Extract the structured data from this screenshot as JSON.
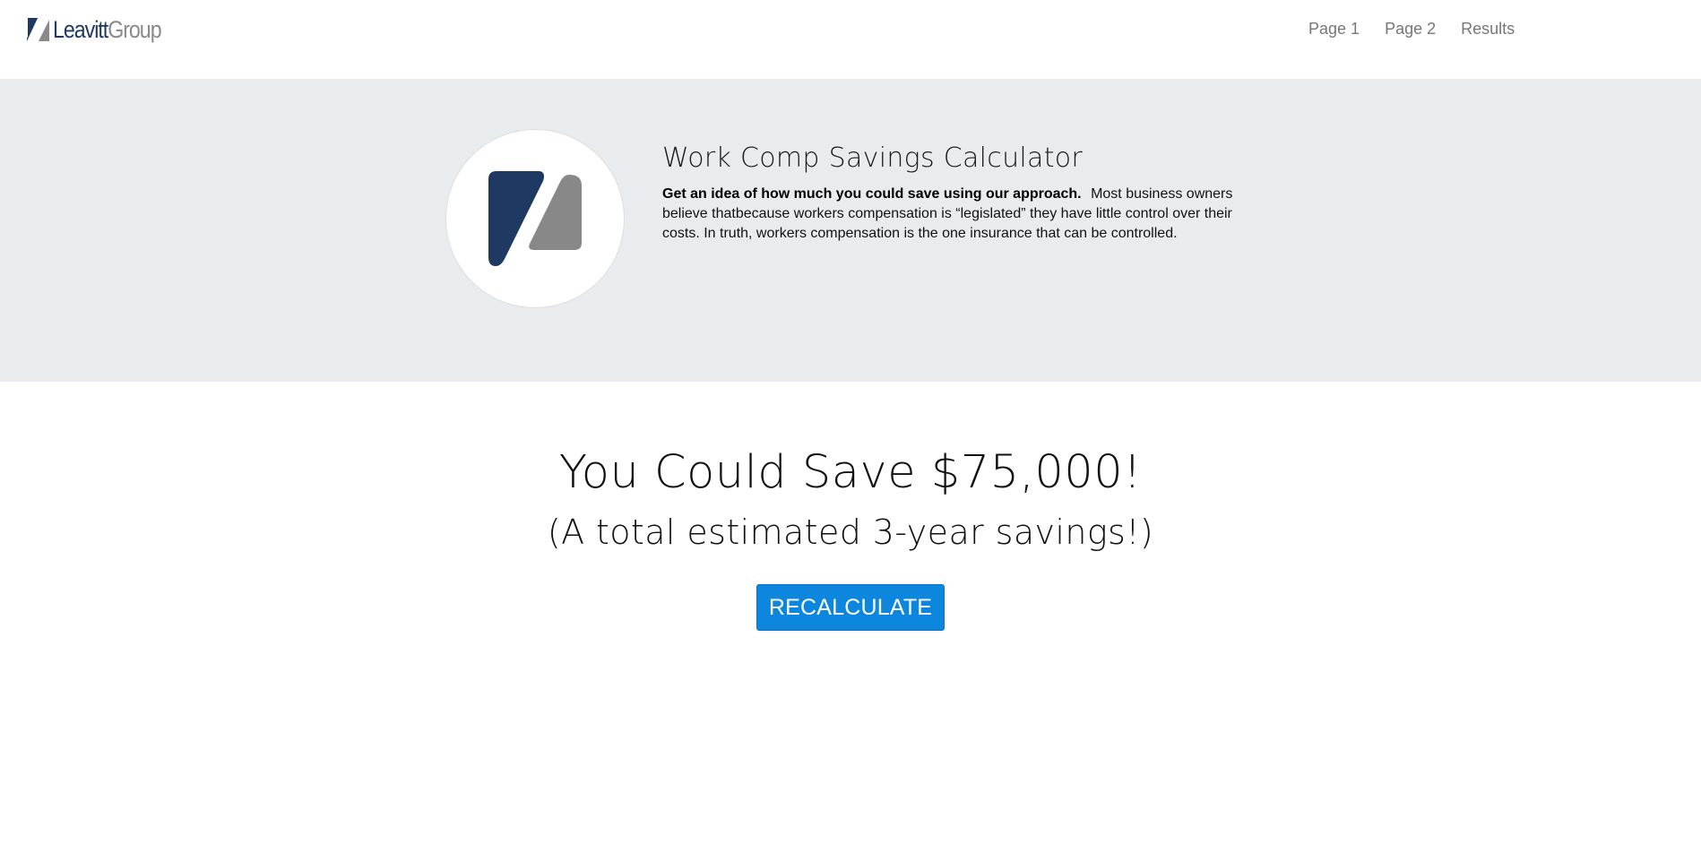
{
  "brand": {
    "name_part1": "Leavitt",
    "name_part2": "Group",
    "colors": {
      "navy": "#1e3a63",
      "gray": "#8a8a8a"
    }
  },
  "nav": {
    "links": [
      {
        "label": "Page 1"
      },
      {
        "label": "Page 2"
      },
      {
        "label": "Results"
      }
    ]
  },
  "hero": {
    "logo_icon": "leavitt-logo-icon",
    "title": "Work Comp Savings Calculator",
    "intro_bold": "Get an idea of how much you could save using our approach.",
    "intro_text": "Most business owners believe thatbecause workers compensation is “legislated” they have little control over their costs. In truth, workers compensation is the one insurance that can be controlled.",
    "background_color": "#e9ecef"
  },
  "result": {
    "headline": "You Could Save $75,000!",
    "subheadline": "(A total estimated 3-year savings!)",
    "button_label": "RECALCULATE",
    "button_color": "#0d86de"
  }
}
